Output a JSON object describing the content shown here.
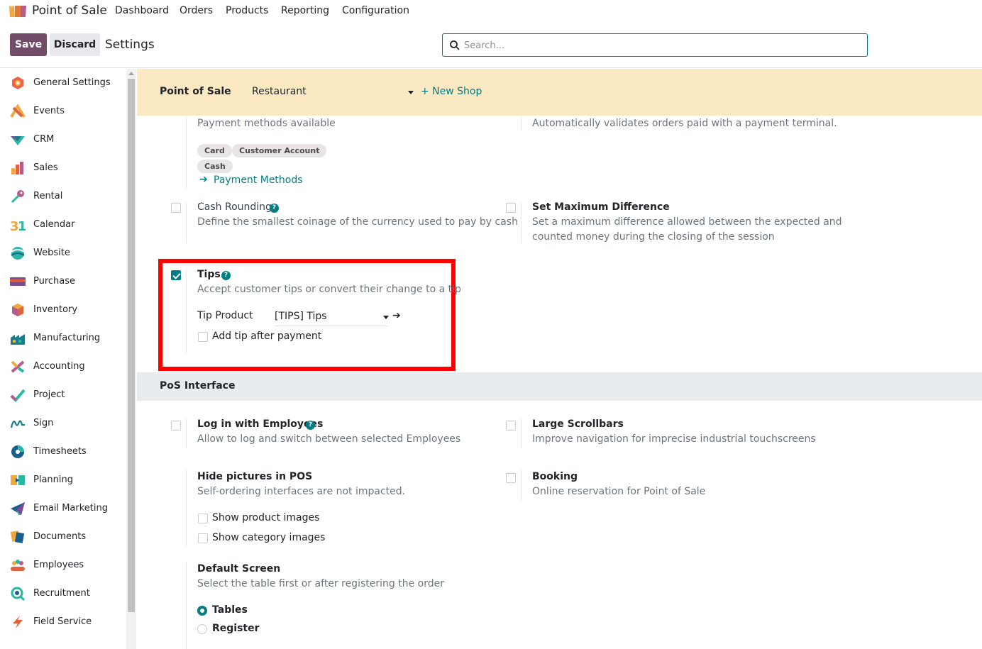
{
  "topnav": {
    "app_name": "Point of Sale",
    "items": [
      "Dashboard",
      "Orders",
      "Products",
      "Reporting",
      "Configuration"
    ]
  },
  "control": {
    "save_label": "Save",
    "discard_label": "Discard",
    "breadcrumb": "Settings",
    "search_placeholder": "Search..."
  },
  "sidebar": {
    "items": [
      {
        "label": "General Settings",
        "icon": "general-settings-icon"
      },
      {
        "label": "Events",
        "icon": "events-icon"
      },
      {
        "label": "CRM",
        "icon": "crm-icon"
      },
      {
        "label": "Sales",
        "icon": "sales-icon"
      },
      {
        "label": "Rental",
        "icon": "rental-icon"
      },
      {
        "label": "Calendar",
        "icon": "calendar-icon"
      },
      {
        "label": "Website",
        "icon": "website-icon"
      },
      {
        "label": "Purchase",
        "icon": "purchase-icon"
      },
      {
        "label": "Inventory",
        "icon": "inventory-icon"
      },
      {
        "label": "Manufacturing",
        "icon": "manufacturing-icon"
      },
      {
        "label": "Accounting",
        "icon": "accounting-icon"
      },
      {
        "label": "Project",
        "icon": "project-icon"
      },
      {
        "label": "Sign",
        "icon": "sign-icon"
      },
      {
        "label": "Timesheets",
        "icon": "timesheets-icon"
      },
      {
        "label": "Planning",
        "icon": "planning-icon"
      },
      {
        "label": "Email Marketing",
        "icon": "email-marketing-icon"
      },
      {
        "label": "Documents",
        "icon": "documents-icon"
      },
      {
        "label": "Employees",
        "icon": "employees-icon"
      },
      {
        "label": "Recruitment",
        "icon": "recruitment-icon"
      },
      {
        "label": "Field Service",
        "icon": "field-service-icon"
      }
    ]
  },
  "company_bar": {
    "label": "Point of Sale",
    "selected": "Restaurant",
    "new_shop": "+ New Shop"
  },
  "payments": {
    "desc": "Payment methods available",
    "tags": [
      "Card",
      "Customer Account",
      "Cash"
    ],
    "link": "Payment Methods",
    "auto_validate_desc": "Automatically validates orders paid with a payment terminal."
  },
  "cash_rounding": {
    "title": "Cash Rounding",
    "desc": "Define the smallest coinage of the currency used to pay by cash",
    "checked": false
  },
  "max_difference": {
    "title": "Set Maximum Difference",
    "desc_line1": "Set a maximum difference allowed between the expected and",
    "desc_line2": "counted money during the closing of the session",
    "checked": false
  },
  "tips": {
    "title": "Tips",
    "desc": "Accept customer tips or convert their change to a tip",
    "checked": true,
    "tip_product_label": "Tip Product",
    "tip_product_value": "[TIPS] Tips",
    "add_after_payment": "Add tip after payment",
    "add_after_payment_checked": false
  },
  "pos_interface": {
    "section_title": "PoS Interface",
    "login_employees": {
      "title": "Log in with Employees",
      "desc": "Allow to log and switch between selected Employees",
      "checked": false
    },
    "large_scrollbars": {
      "title": "Large Scrollbars",
      "desc": "Improve navigation for imprecise industrial touchscreens",
      "checked": false
    },
    "hide_pictures": {
      "title": "Hide pictures in POS",
      "desc": "Self-ordering interfaces are not impacted.",
      "show_product_images": "Show product images",
      "show_category_images": "Show category images"
    },
    "booking": {
      "title": "Booking",
      "desc": "Online reservation for Point of Sale",
      "checked": false
    },
    "default_screen": {
      "title": "Default Screen",
      "desc": "Select the table first or after registering the order",
      "options": [
        "Tables",
        "Register"
      ],
      "selected": "Tables"
    }
  },
  "colors": {
    "brand": "#714B67",
    "accent": "#017e84",
    "company_bar": "#fbe9c3",
    "highlight": "#ff0000"
  }
}
